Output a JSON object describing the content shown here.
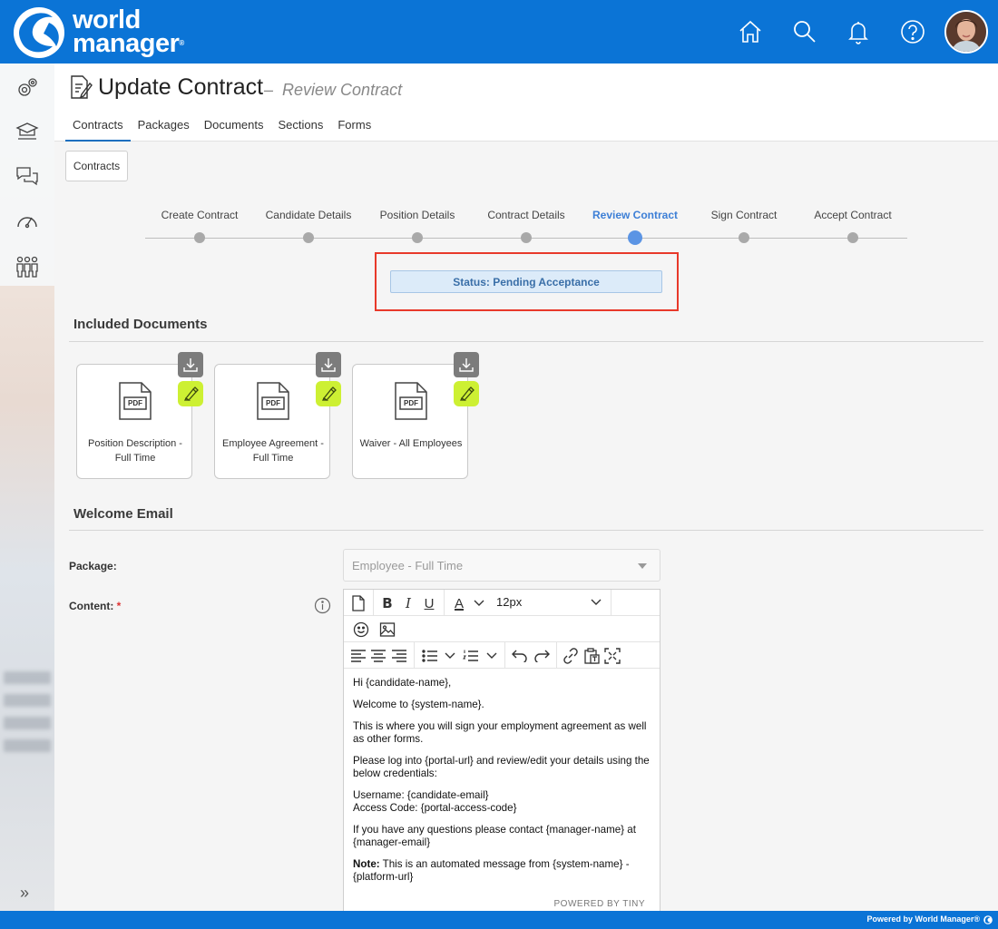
{
  "brand": {
    "line1": "world",
    "line2": "manager",
    "mark": "®",
    "primary_color": "#0b74d6",
    "accent_color": "#cdf033"
  },
  "topbar": {
    "icons": [
      "home-icon",
      "search-icon",
      "bell-icon",
      "help-icon"
    ],
    "avatar": "user-avatar"
  },
  "rail": {
    "icons": [
      "settings-icon",
      "learning-icon",
      "chat-icon",
      "dashboard-icon",
      "people-icon"
    ],
    "expand": "»"
  },
  "header": {
    "title": "Update Contract",
    "separator": "–",
    "subtitle": "Review Contract",
    "tabs": [
      "Contracts",
      "Packages",
      "Documents",
      "Sections",
      "Forms"
    ],
    "active_tab": "Contracts"
  },
  "contracts_button": "Contracts",
  "stepper": {
    "steps": [
      "Create Contract",
      "Candidate Details",
      "Position Details",
      "Contract Details",
      "Review Contract",
      "Sign Contract",
      "Accept Contract"
    ],
    "active_index": 4
  },
  "status": "Status: Pending Acceptance",
  "documents": {
    "title": "Included Documents",
    "pdf_label": "PDF",
    "items": [
      {
        "name": "Position Description - Full Time"
      },
      {
        "name": "Employee Agreement - Full Time"
      },
      {
        "name": "Waiver - All Employees"
      }
    ]
  },
  "welcome": {
    "title": "Welcome Email",
    "package_label": "Package:",
    "package_value": "Employee - Full Time",
    "content_label": "Content:",
    "required_mark": "*",
    "font_size": "12px",
    "body": {
      "p1": "Hi {candidate-name},",
      "p2": "Welcome to {system-name}.",
      "p3": "This is where you will sign your employment agreement as well as other forms.",
      "p4": "Please log into {portal-url} and review/edit your details using the below credentials:",
      "p5a": "Username: {candidate-email}",
      "p5b": "Access Code: {portal-access-code}",
      "p6": "If you have any questions please contact {manager-name} at {manager-email}",
      "p7_bold": "Note:",
      "p7_rest": " This is an automated message from {system-name} - {platform-url}"
    },
    "powered_by": "POWERED BY TINY"
  },
  "footer": {
    "text": "Powered by World Manager®"
  }
}
